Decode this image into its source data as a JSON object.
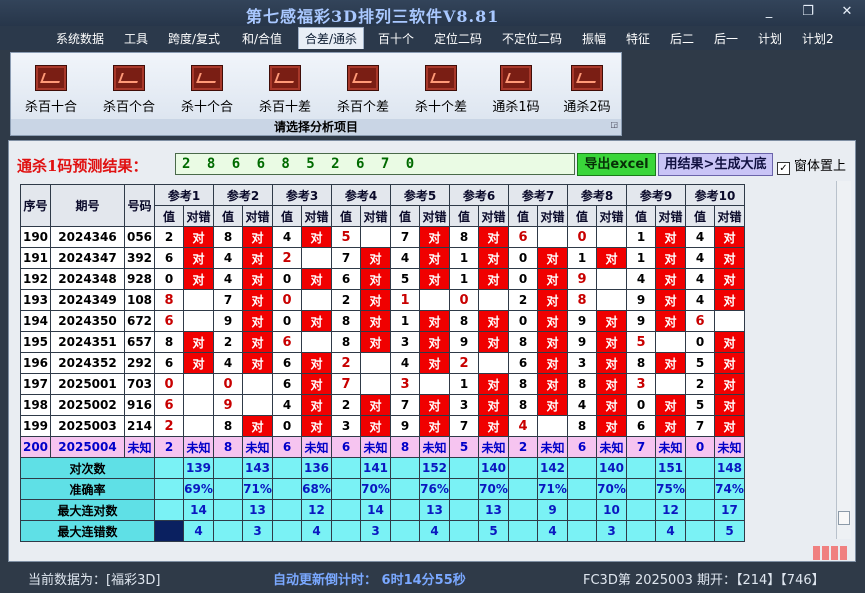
{
  "window": {
    "title": "第七感福彩3D排列三软件V8.81",
    "min": "_",
    "restore": "❐",
    "close": "✕"
  },
  "menu": [
    "系统数据",
    "工具",
    "跨度/复式",
    "和/合值",
    "合差/通杀",
    "百十个",
    "定位二码",
    "不定位二码",
    "振幅",
    "特征",
    "后二",
    "后一",
    "计划",
    "计划2"
  ],
  "menu_active_index": 4,
  "ribbon": {
    "buttons": [
      "杀百十合",
      "杀百个合",
      "杀十个合",
      "杀百十差",
      "杀百个差",
      "杀十个差",
      "通杀1码",
      "通杀2码"
    ],
    "caption": "请选择分析项目"
  },
  "prediction": {
    "label": "通杀1码预测结果：",
    "value": "2 8 6 6 8 5 2 6 7 0",
    "export_btn": "导出excel",
    "generate_btn": "用结果>生成大底",
    "topmost_check": "✓",
    "topmost_label": "窗体置上"
  },
  "table": {
    "col_seq": "序号",
    "col_period": "期号",
    "col_num": "号码",
    "ref_headers": [
      "参考1",
      "参考2",
      "参考3",
      "参考4",
      "参考5",
      "参考6",
      "参考7",
      "参考8",
      "参考9",
      "参考10"
    ],
    "sub_val": "值",
    "sub_dc": "对错",
    "hit_text": "对",
    "rows": [
      {
        "seq": "190",
        "period": "2024346",
        "num": "056",
        "vals": [
          "2",
          "8",
          "4",
          "5",
          "7",
          "8",
          "6",
          "0",
          "1",
          "4"
        ],
        "hits": [
          1,
          1,
          1,
          0,
          1,
          1,
          0,
          0,
          1,
          1
        ],
        "red": [
          0,
          0,
          0,
          1,
          0,
          0,
          1,
          1,
          0,
          0
        ]
      },
      {
        "seq": "191",
        "period": "2024347",
        "num": "392",
        "vals": [
          "6",
          "4",
          "2",
          "7",
          "4",
          "1",
          "0",
          "1",
          "1",
          "4"
        ],
        "hits": [
          1,
          1,
          0,
          1,
          1,
          1,
          1,
          1,
          1,
          1
        ],
        "red": [
          0,
          0,
          1,
          0,
          0,
          0,
          0,
          0,
          0,
          0
        ]
      },
      {
        "seq": "192",
        "period": "2024348",
        "num": "928",
        "vals": [
          "0",
          "4",
          "0",
          "6",
          "5",
          "1",
          "0",
          "9",
          "4",
          "4"
        ],
        "hits": [
          1,
          1,
          1,
          1,
          1,
          1,
          1,
          0,
          1,
          1
        ],
        "red": [
          0,
          0,
          0,
          0,
          0,
          0,
          0,
          1,
          0,
          0
        ]
      },
      {
        "seq": "193",
        "period": "2024349",
        "num": "108",
        "vals": [
          "8",
          "7",
          "0",
          "2",
          "1",
          "0",
          "2",
          "8",
          "9",
          "4"
        ],
        "hits": [
          0,
          1,
          0,
          1,
          0,
          0,
          1,
          0,
          1,
          1
        ],
        "red": [
          1,
          0,
          1,
          0,
          1,
          1,
          0,
          1,
          0,
          0
        ]
      },
      {
        "seq": "194",
        "period": "2024350",
        "num": "672",
        "vals": [
          "6",
          "9",
          "0",
          "8",
          "1",
          "8",
          "0",
          "9",
          "9",
          "6"
        ],
        "hits": [
          0,
          1,
          1,
          1,
          1,
          1,
          1,
          1,
          1,
          0
        ],
        "red": [
          1,
          0,
          0,
          0,
          0,
          0,
          0,
          0,
          0,
          1
        ]
      },
      {
        "seq": "195",
        "period": "2024351",
        "num": "657",
        "vals": [
          "8",
          "2",
          "6",
          "8",
          "3",
          "9",
          "8",
          "9",
          "5",
          "0"
        ],
        "hits": [
          1,
          1,
          0,
          1,
          1,
          1,
          1,
          1,
          0,
          1
        ],
        "red": [
          0,
          0,
          1,
          0,
          0,
          0,
          0,
          0,
          1,
          0
        ]
      },
      {
        "seq": "196",
        "period": "2024352",
        "num": "292",
        "vals": [
          "6",
          "4",
          "6",
          "2",
          "4",
          "2",
          "6",
          "3",
          "8",
          "5"
        ],
        "hits": [
          1,
          1,
          1,
          0,
          1,
          0,
          1,
          1,
          1,
          1
        ],
        "red": [
          0,
          0,
          0,
          1,
          0,
          1,
          0,
          0,
          0,
          0
        ]
      },
      {
        "seq": "197",
        "period": "2025001",
        "num": "703",
        "vals": [
          "0",
          "0",
          "6",
          "7",
          "3",
          "1",
          "8",
          "8",
          "3",
          "2"
        ],
        "hits": [
          0,
          0,
          1,
          0,
          0,
          1,
          1,
          1,
          0,
          1
        ],
        "red": [
          1,
          1,
          0,
          1,
          1,
          0,
          0,
          0,
          1,
          0
        ]
      },
      {
        "seq": "198",
        "period": "2025002",
        "num": "916",
        "vals": [
          "6",
          "9",
          "4",
          "2",
          "7",
          "3",
          "8",
          "4",
          "0",
          "5"
        ],
        "hits": [
          0,
          0,
          1,
          1,
          1,
          1,
          1,
          1,
          1,
          1
        ],
        "red": [
          1,
          1,
          0,
          0,
          0,
          0,
          0,
          0,
          0,
          0
        ]
      },
      {
        "seq": "199",
        "period": "2025003",
        "num": "214",
        "vals": [
          "2",
          "8",
          "0",
          "3",
          "9",
          "7",
          "4",
          "8",
          "6",
          "7"
        ],
        "hits": [
          0,
          1,
          1,
          1,
          1,
          1,
          0,
          1,
          1,
          1
        ],
        "red": [
          1,
          0,
          0,
          0,
          0,
          0,
          1,
          0,
          0,
          0
        ]
      }
    ],
    "current": {
      "seq": "200",
      "period": "2025004",
      "num": "未知",
      "vals": [
        "2",
        "8",
        "6",
        "6",
        "8",
        "5",
        "2",
        "6",
        "7",
        "0"
      ],
      "unknown": "未知"
    },
    "summary": [
      {
        "label": "对次数",
        "values": [
          "139",
          "143",
          "136",
          "141",
          "152",
          "140",
          "142",
          "140",
          "151",
          "148"
        ]
      },
      {
        "label": "准确率",
        "values": [
          "69%",
          "71%",
          "68%",
          "70%",
          "76%",
          "70%",
          "71%",
          "70%",
          "75%",
          "74%"
        ]
      },
      {
        "label": "最大连对数",
        "values": [
          "14",
          "13",
          "12",
          "14",
          "13",
          "13",
          "9",
          "10",
          "12",
          "17"
        ]
      },
      {
        "label": "最大连错数",
        "values": [
          "4",
          "3",
          "4",
          "3",
          "4",
          "5",
          "4",
          "3",
          "4",
          "5"
        ]
      }
    ]
  },
  "status": {
    "current_data": "当前数据为：[福彩3D]",
    "countdown": "自动更新倒计时：  6时14分55秒",
    "draw_info": "FC3D第 2025003 期开：【214】【746】"
  }
}
